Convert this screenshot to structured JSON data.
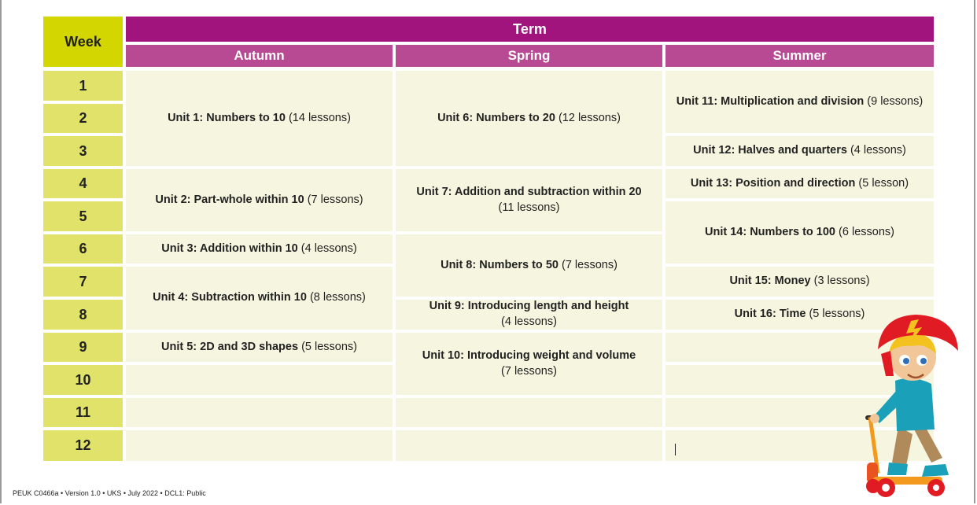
{
  "header": {
    "week": "Week",
    "term": "Term",
    "seasons": [
      "Autumn",
      "Spring",
      "Summer"
    ]
  },
  "weeks": [
    "1",
    "2",
    "3",
    "4",
    "5",
    "6",
    "7",
    "8",
    "9",
    "10",
    "11",
    "12"
  ],
  "autumn": [
    {
      "title": "Unit 1: Numbers to 10",
      "lessons": "(14 lessons)"
    },
    {
      "title": "Unit 2: Part-whole within 10",
      "lessons": "(7 lessons)"
    },
    {
      "title": "Unit 3: Addition within 10",
      "lessons": "(4 lessons)"
    },
    {
      "title": "Unit 4: Subtraction within 10",
      "lessons": "(8 lessons)"
    },
    {
      "title": "Unit 5: 2D and 3D shapes",
      "lessons": "(5 lessons)"
    }
  ],
  "spring": [
    {
      "title": "Unit 6: Numbers to 20",
      "lessons": "(12 lessons)"
    },
    {
      "title": "Unit 7: Addition and subtraction within 20",
      "lessons": "(11 lessons)"
    },
    {
      "title": "Unit 8: Numbers to 50",
      "lessons": "(7 lessons)"
    },
    {
      "title": "Unit 9: Introducing length and height",
      "lessons": "(4 lessons)"
    },
    {
      "title": "Unit 10: Introducing weight and volume",
      "lessons": "(7 lessons)"
    }
  ],
  "summer": [
    {
      "title": "Unit 11: Multiplication and division",
      "lessons": "(9 lessons)"
    },
    {
      "title": "Unit 12: Halves and quarters",
      "lessons": "(4 lessons)"
    },
    {
      "title": "Unit 13: Position and direction",
      "lessons": "(5 lesson)"
    },
    {
      "title": "Unit 14: Numbers to 100",
      "lessons": "(6 lessons)"
    },
    {
      "title": "Unit 15: Money",
      "lessons": "(3 lessons)"
    },
    {
      "title": "Unit 16: Time",
      "lessons": "(5 lessons)"
    }
  ],
  "footer": "PEUK C0466a • Version 1.0 • UKS • July 2022 • DCL1: Public",
  "colors": {
    "term": "#a2147d",
    "season": "#b84a94",
    "week_head": "#d4d600",
    "week_cell": "#e0e26a",
    "unit_bg": "#f6f6e0"
  }
}
